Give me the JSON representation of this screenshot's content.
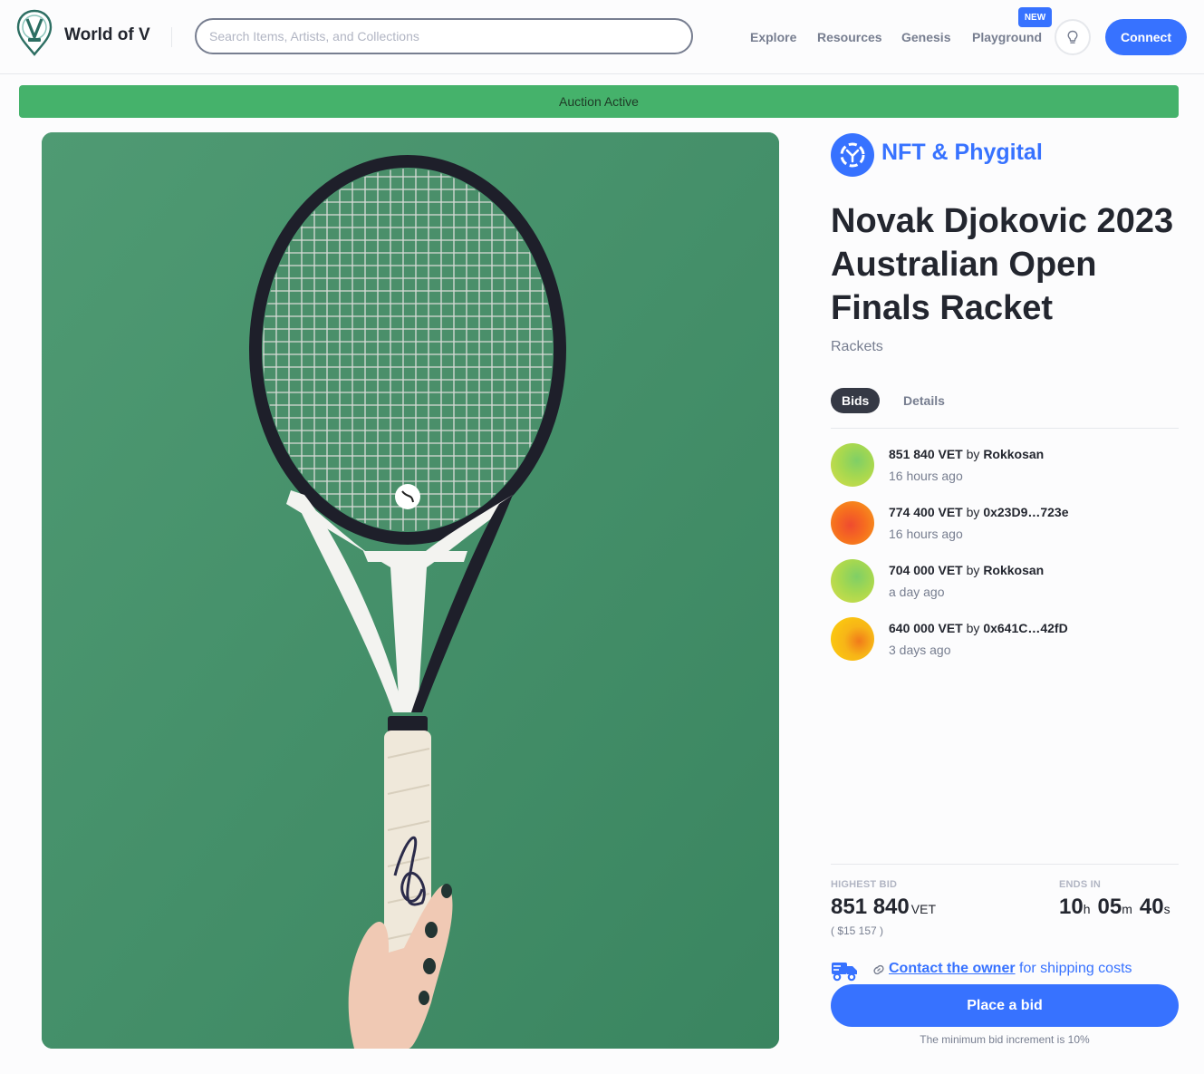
{
  "header": {
    "brand": "World of V",
    "search_placeholder": "Search Items, Artists, and Collections",
    "nav": [
      "Explore",
      "Resources",
      "Genesis",
      "Playground"
    ],
    "new_badge": "NEW",
    "connect_label": "Connect"
  },
  "banner": {
    "status": "Auction Active",
    "color": "#45b26b"
  },
  "item": {
    "category": "NFT & Phygital",
    "title": "Novak Djokovic 2023 Australian Open Finals Racket",
    "collection": "Rackets"
  },
  "tabs": [
    {
      "label": "Bids",
      "active": true
    },
    {
      "label": "Details",
      "active": false
    }
  ],
  "bids": [
    {
      "amount": "851 840 VET",
      "by": "by",
      "bidder": "Rokkosan",
      "time": "16 hours ago"
    },
    {
      "amount": "774 400 VET",
      "by": "by",
      "bidder": "0x23D9…723e",
      "time": "16 hours ago"
    },
    {
      "amount": "704 000 VET",
      "by": "by",
      "bidder": "Rokkosan",
      "time": "a day ago"
    },
    {
      "amount": "640 000 VET",
      "by": "by",
      "bidder": "0x641C…42fD",
      "time": "3 days ago"
    }
  ],
  "summary": {
    "highest_label": "HIGHEST BID",
    "highest_value": "851 840",
    "highest_unit": "VET",
    "highest_usd": "( $15 157 )",
    "ends_label": "ENDS IN",
    "hours": "10",
    "hours_unit": "h",
    "minutes": "05",
    "minutes_unit": "m",
    "seconds": "40",
    "seconds_unit": "s"
  },
  "shipping": {
    "link": "Contact the owner",
    "rest": "for shipping costs"
  },
  "place_bid_label": "Place a bid",
  "min_increment": "The minimum bid increment is 10%",
  "colors": {
    "accent": "#3772ff",
    "success": "#45b26b",
    "text": "#23262f",
    "muted": "#777e90"
  }
}
